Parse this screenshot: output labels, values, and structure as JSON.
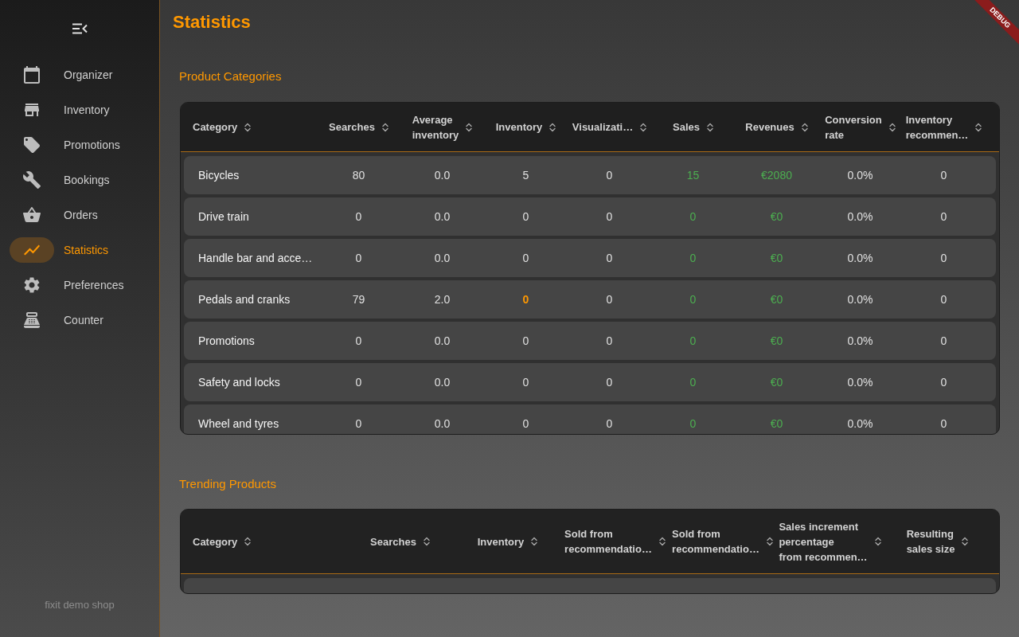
{
  "sidebar": {
    "items": [
      {
        "label": "Organizer",
        "selected": false
      },
      {
        "label": "Inventory",
        "selected": false
      },
      {
        "label": "Promotions",
        "selected": false
      },
      {
        "label": "Bookings",
        "selected": false
      },
      {
        "label": "Orders",
        "selected": false
      },
      {
        "label": "Statistics",
        "selected": true
      },
      {
        "label": "Preferences",
        "selected": false
      },
      {
        "label": "Counter",
        "selected": false
      }
    ],
    "footer": "fixit demo shop"
  },
  "debug_banner": "DEBUG",
  "page_title": "Statistics",
  "product_categories": {
    "title": "Product Categories",
    "columns": [
      {
        "label": "Category",
        "kind": "text"
      },
      {
        "label": "Searches",
        "kind": "number"
      },
      {
        "label": "Average\ninventory",
        "kind": "number"
      },
      {
        "label": "Inventory",
        "kind": "stock"
      },
      {
        "label": "Visualizati…",
        "kind": "number"
      },
      {
        "label": "Sales",
        "kind": "positive"
      },
      {
        "label": "Revenues",
        "kind": "positive"
      },
      {
        "label": "Conversion\nrate",
        "kind": "number"
      },
      {
        "label": "Inventory\nrecommen…",
        "kind": "number"
      }
    ],
    "rows": [
      {
        "cells": [
          "Bicycles",
          "80",
          "0.0",
          "5",
          "0",
          "15",
          "€2080",
          "0.0%",
          "0"
        ],
        "low_stock": false
      },
      {
        "cells": [
          "Drive train",
          "0",
          "0.0",
          "0",
          "0",
          "0",
          "€0",
          "0.0%",
          "0"
        ],
        "low_stock": false
      },
      {
        "cells": [
          "Handle bar and acce…",
          "0",
          "0.0",
          "0",
          "0",
          "0",
          "€0",
          "0.0%",
          "0"
        ],
        "low_stock": false
      },
      {
        "cells": [
          "Pedals and cranks",
          "79",
          "2.0",
          "0",
          "0",
          "0",
          "€0",
          "0.0%",
          "0"
        ],
        "low_stock": true
      },
      {
        "cells": [
          "Promotions",
          "0",
          "0.0",
          "0",
          "0",
          "0",
          "€0",
          "0.0%",
          "0"
        ],
        "low_stock": false
      },
      {
        "cells": [
          "Safety and locks",
          "0",
          "0.0",
          "0",
          "0",
          "0",
          "€0",
          "0.0%",
          "0"
        ],
        "low_stock": false
      },
      {
        "cells": [
          "Wheel and tyres",
          "0",
          "0.0",
          "0",
          "0",
          "0",
          "€0",
          "0.0%",
          "0"
        ],
        "low_stock": false
      }
    ]
  },
  "trending_products": {
    "title": "Trending Products",
    "columns": [
      {
        "label": "Category"
      },
      {
        "label": "Searches"
      },
      {
        "label": "Inventory"
      },
      {
        "label": "Sold from\nrecommendatio…"
      },
      {
        "label": "Sold from\nrecommendatio…"
      },
      {
        "label": "Sales increment\npercentage\nfrom recommen…"
      },
      {
        "label": "Resulting\nsales size"
      }
    ]
  }
}
